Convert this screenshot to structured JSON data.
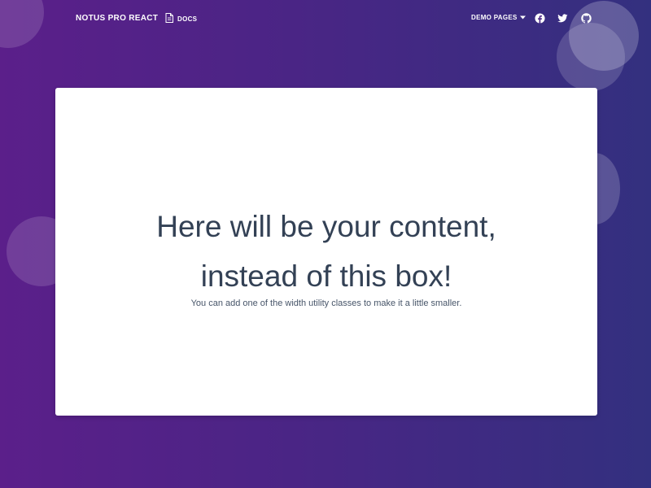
{
  "navbar": {
    "brand": "NOTUS PRO REACT",
    "docs_label": "DOCS",
    "demo_pages_label": "DEMO PAGES",
    "social": [
      {
        "icon": "facebook-icon"
      },
      {
        "icon": "twitter-icon"
      },
      {
        "icon": "github-icon"
      }
    ]
  },
  "card": {
    "heading_line1": "Here will be your content,",
    "heading_line2": "instead of this box!",
    "subtext": "You can add one of the width utility classes to make it a little smaller."
  },
  "colors": {
    "gradient_start": "#5b1f8a",
    "gradient_end": "#33307f",
    "card_background": "#ffffff",
    "heading_text": "#334155"
  }
}
